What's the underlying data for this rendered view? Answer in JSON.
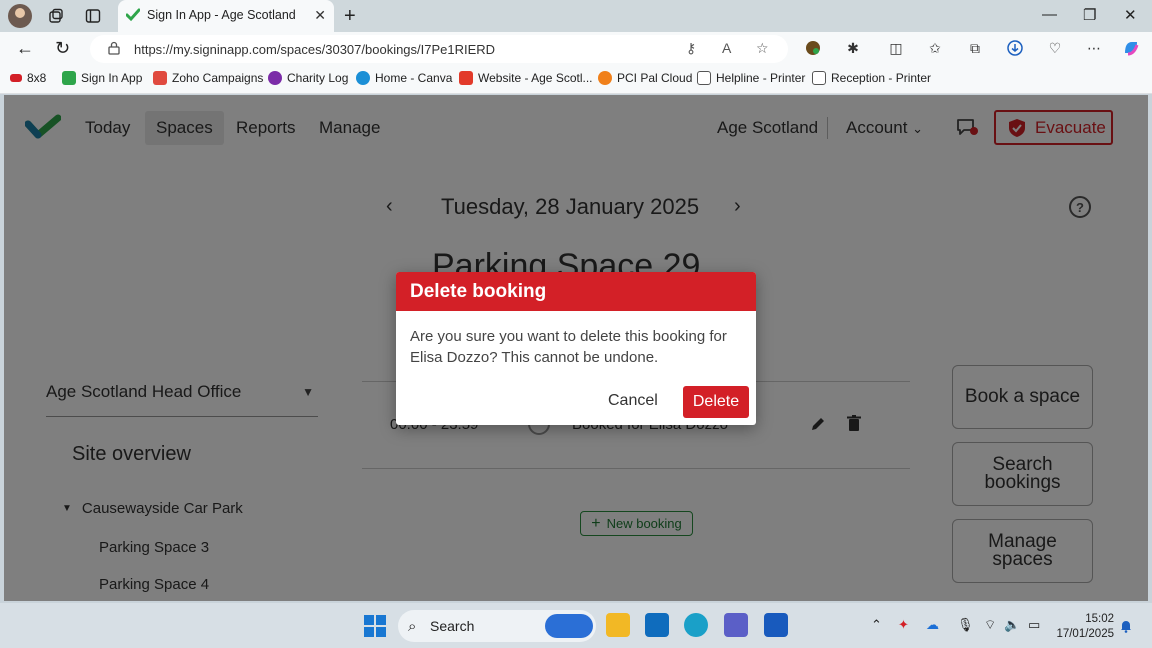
{
  "browser": {
    "tab_title": "Sign In App - Age Scotland",
    "url": "https://my.signinapp.com/spaces/30307/bookings/I7Pe1RIERD",
    "bookmarks": [
      {
        "label": "8x8",
        "color": "#d32027"
      },
      {
        "label": "Sign In App",
        "color": "#2ea54a"
      },
      {
        "label": "Zoho Campaigns",
        "color": "#e04a3f"
      },
      {
        "label": "Charity Log",
        "color": "#7b2ca8"
      },
      {
        "label": "Home - Canva",
        "color": "#1b8fd6"
      },
      {
        "label": "Website - Age Scotl...",
        "color": "#e23a2a"
      },
      {
        "label": "PCI Pal Cloud",
        "color": "#f0801a"
      },
      {
        "label": "Helpline - Printer",
        "color": "#555555"
      },
      {
        "label": "Reception - Printer",
        "color": "#555555"
      }
    ]
  },
  "app": {
    "nav": {
      "today": "Today",
      "spaces": "Spaces",
      "reports": "Reports",
      "manage": "Manage"
    },
    "organisation": "Age Scotland",
    "account": "Account",
    "evacuate": "Evacuate",
    "accent_color": "#d32027",
    "date": "Tuesday, 28 January 2025",
    "space_title": "Parking Space 29",
    "site": "Age Scotland Head Office",
    "site_overview": "Site overview",
    "tree": {
      "group": "Causewayside Car Park",
      "items": [
        "Parking Space 3",
        "Parking Space 4"
      ]
    },
    "booking": {
      "time": "00:00 - 23:59",
      "description": "Booked for Elisa Dozzo"
    },
    "new_booking": "New booking",
    "side_buttons": [
      "Book a space",
      "Search bookings",
      "Manage spaces"
    ]
  },
  "dialog": {
    "title": "Delete booking",
    "body": "Are you sure you want to delete this booking for Elisa Dozzo? This cannot be undone.",
    "cancel": "Cancel",
    "delete": "Delete"
  },
  "taskbar": {
    "search_placeholder": "Search",
    "time": "15:02",
    "date": "17/01/2025"
  }
}
